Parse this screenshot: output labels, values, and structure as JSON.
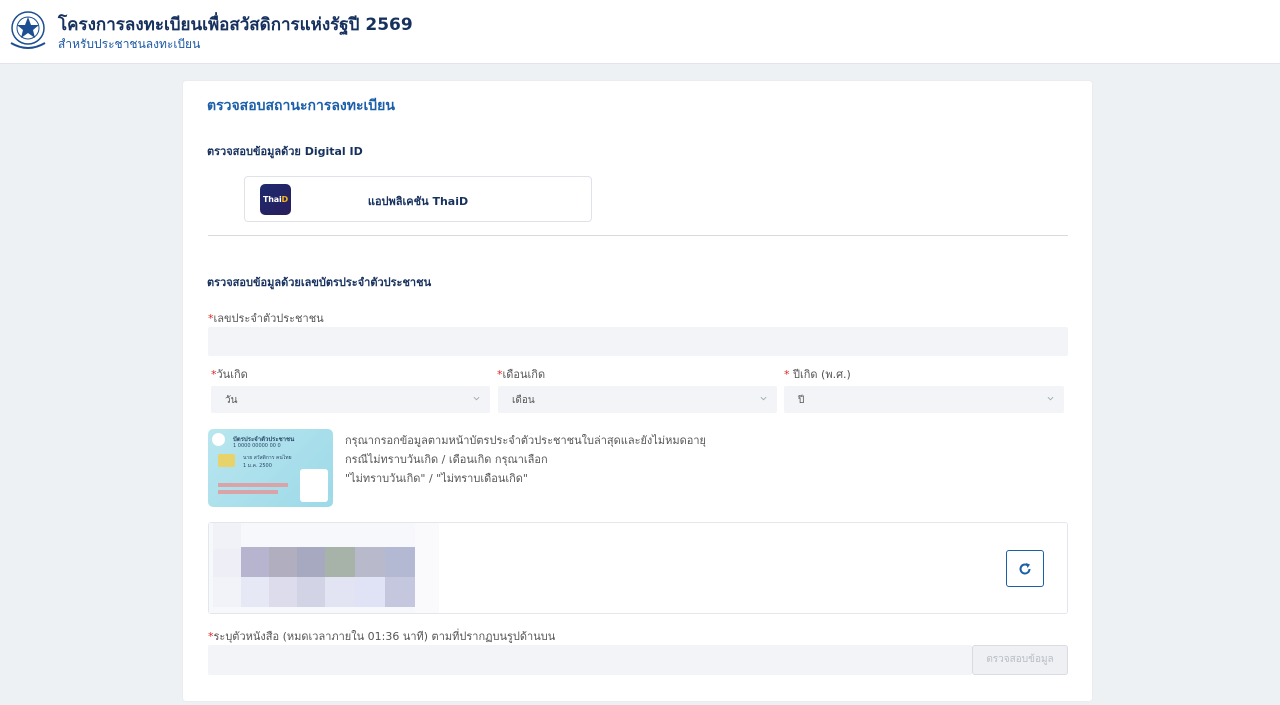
{
  "header": {
    "title": "โครงการลงทะเบียนเพื่อสวัสดิการแห่งรัฐปี 2569",
    "subtitle": "สำหรับประชาชนลงทะเบียน",
    "logo_icon": "ministry-seal-icon"
  },
  "card": {
    "title": "ตรวจสอบสถานะการลงทะเบียน"
  },
  "digital_id": {
    "section_title": "ตรวจสอบข้อมูลด้วย Digital ID",
    "thaid_button_label": "แอปพลิเคชัน ThaiD",
    "thaid_logo_text": "Thai",
    "thaid_logo_accent": "D"
  },
  "id_card_section": {
    "section_title": "ตรวจสอบข้อมูลด้วยเลขบัตรประจำตัวประชาชน",
    "required_mark": "*",
    "id_number_label": "เลขประจำตัวประชาชน",
    "id_number_value": "",
    "birth_day_label": "วันเกิด",
    "birth_day_selected": "วัน",
    "birth_month_label": "เดือนเกิด",
    "birth_month_selected": "เดือน",
    "birth_year_label": " ปีเกิด (พ.ศ.)",
    "birth_year_selected": "ปี"
  },
  "sample_card": {
    "title": "บัตรประจำตัวประชาชน",
    "number": "1 0000 00000 00 0",
    "name": "นาย สวัสดิการ คนไทย",
    "date": "1 ม.ค. 2500"
  },
  "hints": {
    "line1": "กรุณากรอกข้อมูลตามหน้าบัตรประจำตัวประชาชนใบล่าสุดและยังไม่หมดอายุ",
    "line2": "กรณีไม่ทราบวันเกิด / เดือนเกิด กรุณาเลือก",
    "line3": "\"ไม่ทราบวันเกิด\" / \"ไม่ทราบเดือนเกิด\""
  },
  "captcha": {
    "refresh_icon": "refresh-icon",
    "input_label": "ระบุตัวหนังสือ (หมดเวลาภายใน 01:36 นาที) ตามที่ปรากฏบนรูปด้านบน",
    "input_value": "",
    "submit_label": "ตรวจสอบข้อมูล"
  },
  "colors": {
    "brand_navy": "#17315e",
    "accent_blue": "#1c5fa9",
    "required_red": "#e02424",
    "page_bg": "#eef1f4"
  }
}
